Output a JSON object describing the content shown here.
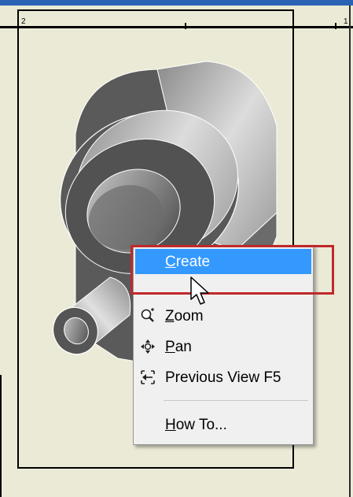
{
  "drawing": {
    "zones": [
      "2",
      "1"
    ]
  },
  "context_menu": {
    "items": [
      {
        "pre": "",
        "mnemonic": "C",
        "post": "reate",
        "icon": "none"
      },
      {
        "pre": "",
        "mnemonic": "Z",
        "post": "oom",
        "icon": "zoom-icon"
      },
      {
        "pre": "",
        "mnemonic": "P",
        "post": "an",
        "icon": "pan-icon"
      },
      {
        "pre": "Previous View F5",
        "mnemonic": "",
        "post": "",
        "icon": "previous-view-icon"
      },
      {
        "pre": "",
        "mnemonic": "H",
        "post": "ow To...",
        "icon": "none"
      }
    ]
  },
  "colors": {
    "selection": "#3399ff",
    "highlight_frame": "#c0282a",
    "sheet": "#ebead6",
    "title_bar": "#2a63b4"
  }
}
